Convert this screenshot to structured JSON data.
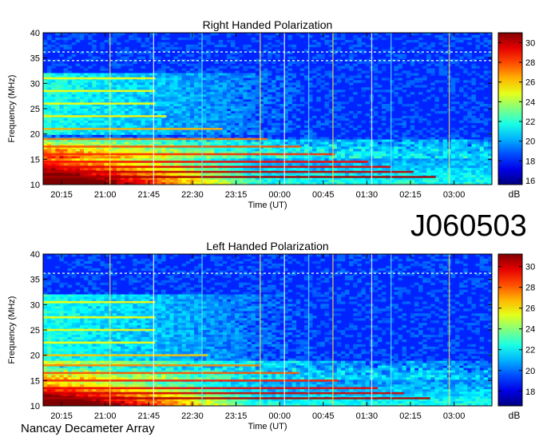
{
  "figure": {
    "id_label": "J060503",
    "footer_label": "Nancay Decameter Array"
  },
  "chart_data": [
    {
      "type": "heatmap",
      "title": "Right Handed Polarization",
      "xlabel": "Time (UT)",
      "ylabel": "Frequency (MHz)",
      "x_ticks": [
        "20:15",
        "21:00",
        "21:45",
        "22:30",
        "23:15",
        "00:00",
        "00:45",
        "01:30",
        "02:15",
        "03:00"
      ],
      "y_ticks": [
        10,
        15,
        20,
        25,
        30,
        35,
        40
      ],
      "ylim": [
        10,
        40
      ],
      "colorbar": {
        "label": "dB",
        "ticks": [
          16,
          18,
          20,
          22,
          24,
          26,
          28,
          30
        ],
        "range": [
          15.6,
          31
        ],
        "colormap": "jet"
      },
      "features": {
        "strong_emission_band_mhz": [
          10,
          20
        ],
        "strong_emission_time_span": [
          "19:55",
          "23:20"
        ],
        "interference_lines_mhz": [
          11.5,
          12.5,
          13.5,
          14.5,
          16,
          17.5,
          19,
          21,
          23.5,
          26,
          28.5,
          31
        ],
        "narrowband_dashed_mhz": [
          36.2,
          34.5
        ],
        "broadband_vertical_times": [
          "21:05",
          "21:50",
          "22:40",
          "23:40",
          "00:05",
          "00:30",
          "00:55",
          "01:35",
          "01:55",
          "02:55"
        ]
      }
    },
    {
      "type": "heatmap",
      "title": "Left Handed Polarization",
      "xlabel": "Time (UT)",
      "ylabel": "Frequency (MHz)",
      "x_ticks": [
        "20:15",
        "21:00",
        "21:45",
        "22:30",
        "23:15",
        "00:00",
        "00:45",
        "01:30",
        "02:15",
        "03:00"
      ],
      "y_ticks": [
        10,
        15,
        20,
        25,
        30,
        35,
        40
      ],
      "ylim": [
        10,
        40
      ],
      "colorbar": {
        "label": "dB",
        "ticks": [
          18,
          20,
          22,
          24,
          26,
          28,
          30
        ],
        "range": [
          16.6,
          31.2
        ],
        "colormap": "jet"
      },
      "features": {
        "strong_emission_band_mhz": [
          10,
          18
        ],
        "strong_emission_time_span": [
          "19:55",
          "23:20"
        ],
        "interference_lines_mhz": [
          11.5,
          12.5,
          13.5,
          15,
          16.5,
          18,
          20,
          22.5,
          25,
          27.5,
          30.5
        ],
        "narrowband_dashed_mhz": [
          36.2
        ],
        "broadband_vertical_times": [
          "21:05",
          "21:50",
          "22:40",
          "23:40",
          "00:05",
          "00:30",
          "00:55",
          "01:35",
          "01:55",
          "02:55"
        ]
      }
    }
  ]
}
